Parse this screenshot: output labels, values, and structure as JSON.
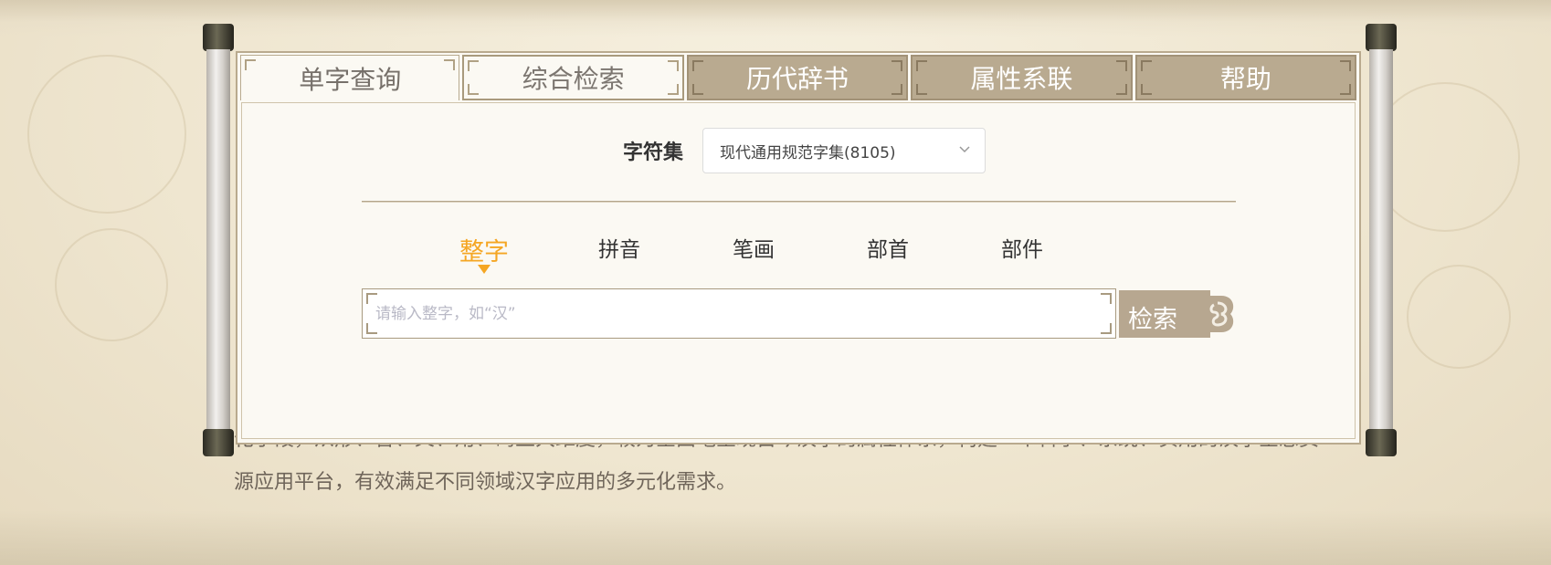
{
  "tabs": [
    {
      "label": "单字查询",
      "state": "active"
    },
    {
      "label": "综合检索",
      "state": "plain"
    },
    {
      "label": "历代辞书",
      "state": "dark"
    },
    {
      "label": "属性系联",
      "state": "dark"
    },
    {
      "label": "帮助",
      "state": "dark"
    }
  ],
  "charset": {
    "label": "字符集",
    "selected": "现代通用规范字集(8105)"
  },
  "modes": [
    {
      "label": "整字",
      "active": true
    },
    {
      "label": "拼音",
      "active": false
    },
    {
      "label": "笔画",
      "active": false
    },
    {
      "label": "部首",
      "active": false
    },
    {
      "label": "部件",
      "active": false
    }
  ],
  "search": {
    "placeholder": "请输入整字，如“汉”",
    "button_label": "检索"
  },
  "background_text": {
    "line1": "化手段，从形、音、义、用、码五大维度，较为全面地呈现古今汉字的属性体系，构建一个科学、系统、实用的汉字全息资",
    "line2": "源应用平台，有效满足不同领域汉字应用的多元化需求。"
  },
  "colors": {
    "accent": "#f5a623",
    "tab_dark": "#b9aa90",
    "search_button": "#b7a790"
  }
}
